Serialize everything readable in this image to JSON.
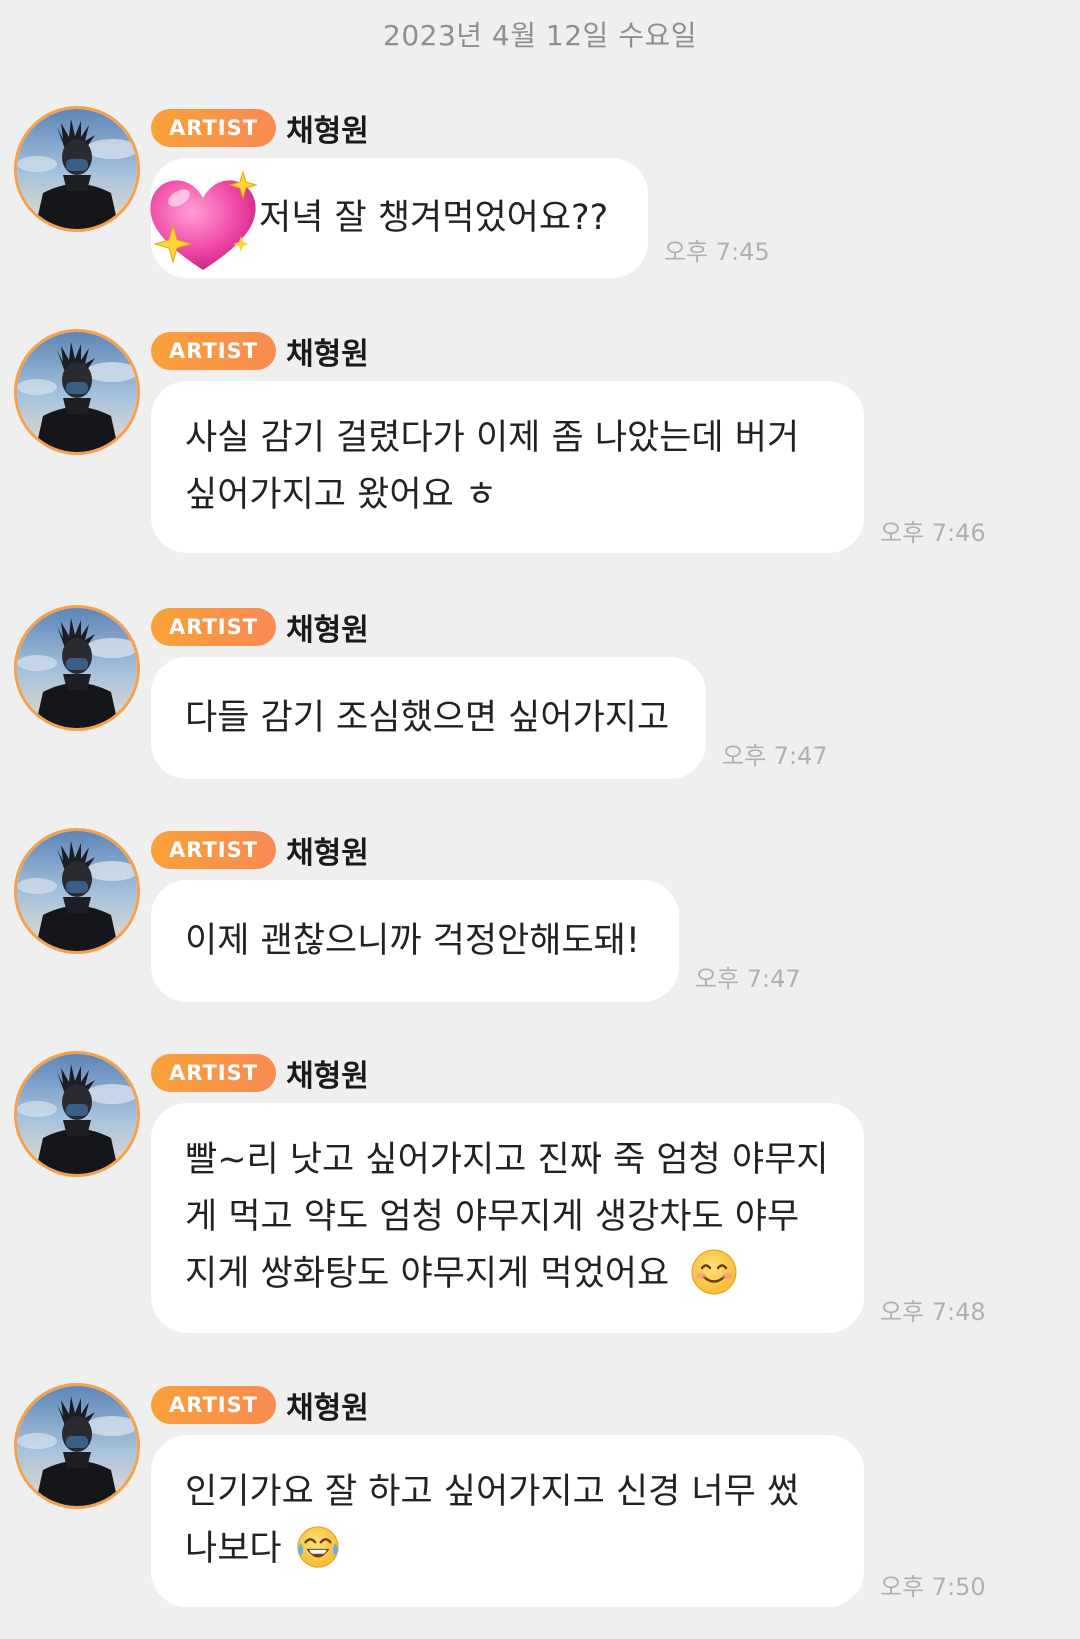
{
  "date_header": "2023년 4월 12일 수요일",
  "badge_label": "ARTIST",
  "sender_name": "채형원",
  "messages": [
    {
      "text": "저녁 잘 챙겨먹었어요??",
      "time": "오후 7:45",
      "leading_icon": "sparkling-heart-emoji"
    },
    {
      "lines": [
        "사실 감기 걸렸다가 이제 좀 나았는데 버거",
        "싶어가지고 왔어요 ㅎ"
      ],
      "time": "오후 7:46"
    },
    {
      "text": "다들 감기 조심했으면 싶어가지고",
      "time": "오후 7:47"
    },
    {
      "text": "이제 괜찮으니까 걱정안해도돼!",
      "time": "오후 7:47"
    },
    {
      "lines": [
        "빨~리 낫고 싶어가지고 진짜 죽 엄청 야무지",
        "게 먹고 약도 엄청 야무지게 생강차도 야무",
        "지게 쌍화탕도 야무지게 먹었어요"
      ],
      "time": "오후 7:48",
      "trailing_icon": "smiling-face-emoji"
    },
    {
      "lines": [
        "인기가요 잘 하고 싶어가지고 신경 너무 썼",
        "나보다"
      ],
      "time": "오후 7:50",
      "trailing_icon": "tears-of-joy-emoji"
    }
  ],
  "colors": {
    "background": "#efefef",
    "bubble": "#ffffff",
    "badge_start": "#f9a23a",
    "badge_end": "#f98a52",
    "avatar_ring": "#f4a04c",
    "time_text": "#b0b0b0",
    "date_text": "#8f8f8f"
  }
}
